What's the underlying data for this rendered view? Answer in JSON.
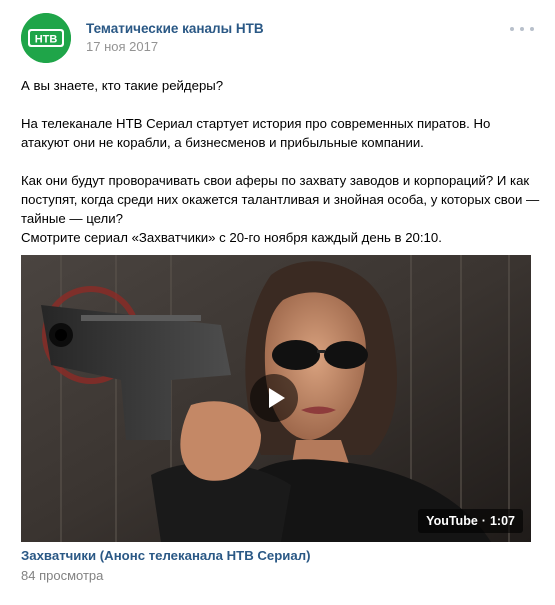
{
  "post": {
    "author": "Тематические каналы НТВ",
    "date": "17 ноя 2017",
    "avatar_logo": "НТВ",
    "paragraphs": [
      "А вы знаете, кто такие рейдеры?",
      "На телеканале НТВ Сериал стартует история про современных пиратов. Но атакуют они не корабли, а бизнесменов и прибыльные компании.",
      "Как они будут проворачивать свои аферы по захвату заводов и корпораций? И как поступят, когда среди них окажется талантливая и знойная особа, у которых свои — тайные — цели?",
      "Смотрите сериал «Захватчики» с 20-го ноября каждый день в 20:10."
    ],
    "more_icon": "more-dots-icon"
  },
  "video": {
    "source": "YouTube",
    "separator": "·",
    "duration": "1:07",
    "title": "Захватчики (Анонс телеканала НТВ Сериал)",
    "views": "84 просмотра",
    "play_icon": "play-icon"
  },
  "colors": {
    "link": "#2a5885",
    "meta": "#939393",
    "logo_green": "#1fa549"
  }
}
